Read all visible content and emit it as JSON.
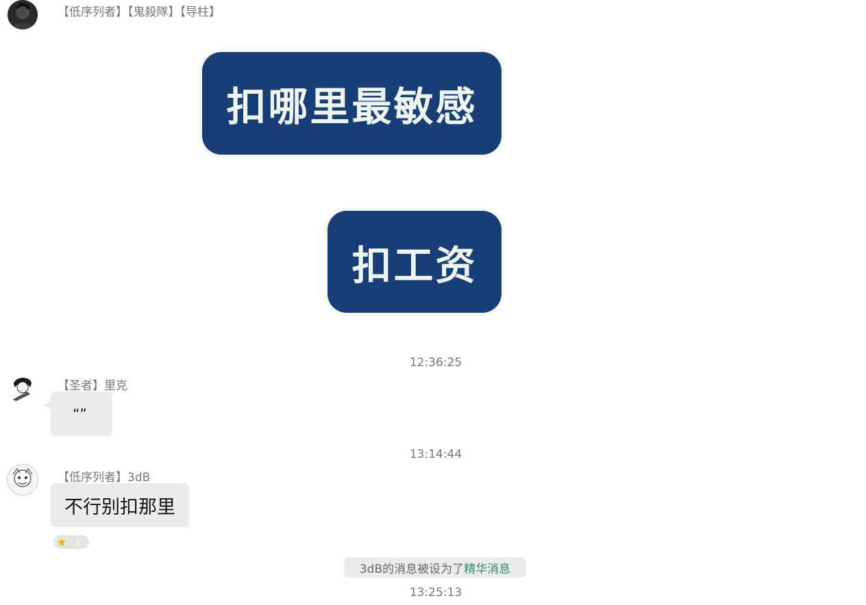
{
  "messages": {
    "msg1": {
      "sender": "【低序列者】【鬼殺隊】【导柱】",
      "bubble1": "扣哪里最敏感",
      "bubble2": "扣工资"
    },
    "time1": "12:36:25",
    "msg2": {
      "sender": "【圣者】里克",
      "text": "“”"
    },
    "time2": "13:14:44",
    "msg3": {
      "sender": "【低序列者】3dB",
      "text": "不行别扣那里",
      "badge": "1"
    },
    "system": {
      "prefix": "3dB的消息被设为了",
      "highlight": "精华消息"
    },
    "time3": "13:25:13"
  },
  "colors": {
    "sticker_bg": "#173e77",
    "sticker_text": "#eef5ee",
    "bubble_bg": "#ececec",
    "highlight": "#2f8f6a"
  }
}
